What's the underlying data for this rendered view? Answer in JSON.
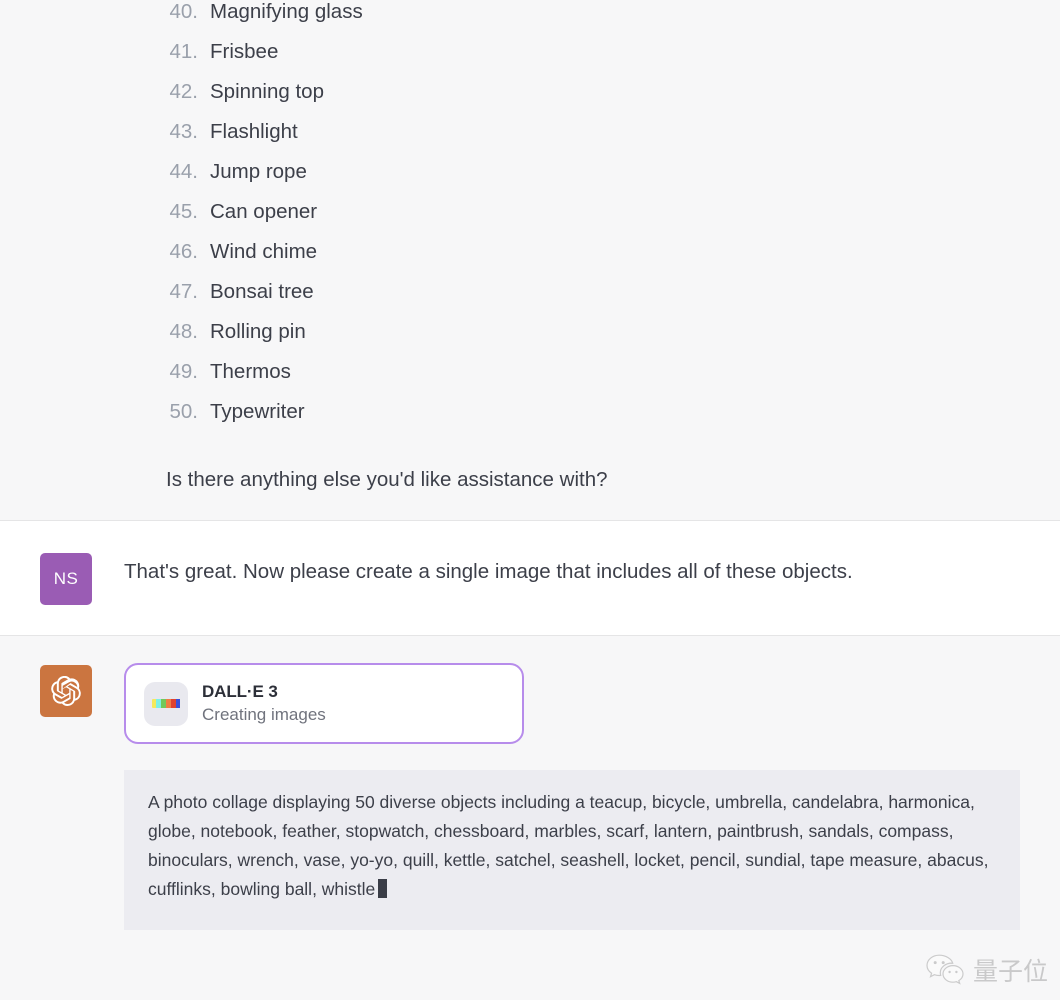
{
  "colors": {
    "page_background": "#f7f7f8",
    "user_turn_background": "#ffffff",
    "user_avatar": "#9a5cb4",
    "assistant_avatar": "#cb7540",
    "tool_card_border": "#b78ceb",
    "prompt_block_background": "#ececf1",
    "list_number": "#9aa0ab",
    "body_text": "#3c3f49"
  },
  "assistant_list_turn": {
    "avatar_icon": "openai-logo-icon",
    "list_items": [
      {
        "number": "40.",
        "label": "Magnifying glass"
      },
      {
        "number": "41.",
        "label": "Frisbee"
      },
      {
        "number": "42.",
        "label": "Spinning top"
      },
      {
        "number": "43.",
        "label": "Flashlight"
      },
      {
        "number": "44.",
        "label": "Jump rope"
      },
      {
        "number": "45.",
        "label": "Can opener"
      },
      {
        "number": "46.",
        "label": "Wind chime"
      },
      {
        "number": "47.",
        "label": "Bonsai tree"
      },
      {
        "number": "48.",
        "label": "Rolling pin"
      },
      {
        "number": "49.",
        "label": "Thermos"
      },
      {
        "number": "50.",
        "label": "Typewriter"
      }
    ],
    "closing_line": "Is there anything else you'd like assistance with?"
  },
  "user_turn": {
    "avatar_initials": "NS",
    "message": "That's great.  Now please create a single image that includes all of these objects."
  },
  "assistant_tool_turn": {
    "avatar_icon": "openai-logo-icon",
    "tool_card": {
      "icon": "dalle-swatches-icon",
      "swatch_colors": [
        "#f5e95c",
        "#7ef0e6",
        "#72c85a",
        "#ef7d45",
        "#e0422f",
        "#3b4fd8"
      ],
      "title": "DALL·E 3",
      "subtitle": "Creating images"
    },
    "prompt_text": "A photo collage displaying 50 diverse objects including a teacup, bicycle, umbrella, candelabra, harmonica, globe, notebook, feather, stopwatch, chessboard, marbles, scarf, lantern, paintbrush, sandals, compass, binoculars, wrench, vase, yo-yo, quill, kettle, satchel, seashell, locket, pencil, sundial, tape measure, abacus, cufflinks, bowling ball, whistle"
  },
  "watermark": {
    "icon": "wechat-icon",
    "text": "量子位"
  }
}
